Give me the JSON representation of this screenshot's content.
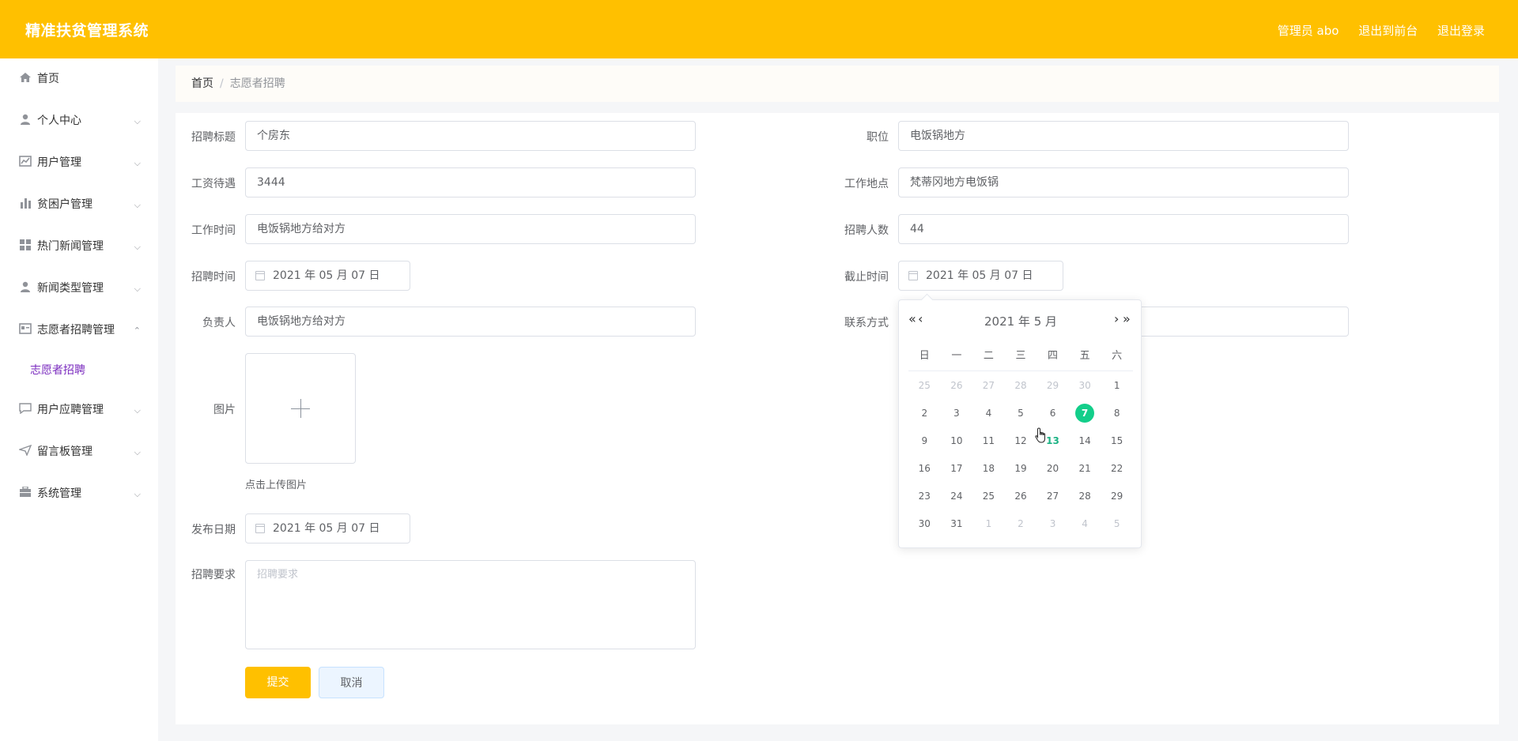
{
  "header": {
    "title": "精准扶贫管理系统",
    "user": "管理员 abo",
    "to_front": "退出到前台",
    "logout": "退出登录"
  },
  "sidebar": {
    "items": [
      {
        "label": "首页",
        "icon": "home-icon"
      },
      {
        "label": "个人中心",
        "icon": "user-icon"
      },
      {
        "label": "用户管理",
        "icon": "chart-icon"
      },
      {
        "label": "贫困户管理",
        "icon": "bar-chart-icon"
      },
      {
        "label": "热门新闻管理",
        "icon": "grid-icon"
      },
      {
        "label": "新闻类型管理",
        "icon": "user-icon"
      },
      {
        "label": "志愿者招聘管理",
        "icon": "card-icon"
      },
      {
        "label": "用户应聘管理",
        "icon": "chat-icon"
      },
      {
        "label": "留言板管理",
        "icon": "send-icon"
      },
      {
        "label": "系统管理",
        "icon": "briefcase-icon"
      }
    ],
    "sub_item": "志愿者招聘"
  },
  "breadcrumb": {
    "home": "首页",
    "separator": "/",
    "current": "志愿者招聘"
  },
  "form": {
    "title_label": "招聘标题",
    "title_value": "个房东",
    "position_label": "职位",
    "position_value": "电饭锅地方",
    "salary_label": "工资待遇",
    "salary_value": "3444",
    "location_label": "工作地点",
    "location_value": "梵蒂冈地方电饭锅",
    "worktime_label": "工作时间",
    "worktime_value": "电饭锅地方给对方",
    "count_label": "招聘人数",
    "count_value": "44",
    "recruit_time_label": "招聘时间",
    "recruit_time_value": "2021 年 05 月 07 日",
    "deadline_label": "截止时间",
    "deadline_value": "2021 年 05 月 07 日",
    "owner_label": "负责人",
    "owner_value": "电饭锅地方给对方",
    "contact_label": "联系方式",
    "contact_value": "",
    "image_label": "图片",
    "upload_hint": "点击上传图片",
    "publish_label": "发布日期",
    "publish_value": "2021 年 05 月 07 日",
    "requirement_label": "招聘要求",
    "requirement_placeholder": "招聘要求",
    "submit": "提交",
    "cancel": "取消"
  },
  "datepicker": {
    "year_month": "2021 年  5 月",
    "prev_year": "«",
    "prev_month": "‹",
    "next_month": "›",
    "next_year": "»",
    "weekdays": [
      "日",
      "一",
      "二",
      "三",
      "四",
      "五",
      "六"
    ],
    "weeks": [
      [
        {
          "d": "25",
          "o": true
        },
        {
          "d": "26",
          "o": true
        },
        {
          "d": "27",
          "o": true
        },
        {
          "d": "28",
          "o": true
        },
        {
          "d": "29",
          "o": true
        },
        {
          "d": "30",
          "o": true
        },
        {
          "d": "1"
        }
      ],
      [
        {
          "d": "2"
        },
        {
          "d": "3"
        },
        {
          "d": "4"
        },
        {
          "d": "5"
        },
        {
          "d": "6"
        },
        {
          "d": "7",
          "s": true
        },
        {
          "d": "8"
        }
      ],
      [
        {
          "d": "9"
        },
        {
          "d": "10"
        },
        {
          "d": "11"
        },
        {
          "d": "12"
        },
        {
          "d": "13",
          "t": true
        },
        {
          "d": "14"
        },
        {
          "d": "15"
        }
      ],
      [
        {
          "d": "16"
        },
        {
          "d": "17"
        },
        {
          "d": "18"
        },
        {
          "d": "19"
        },
        {
          "d": "20"
        },
        {
          "d": "21"
        },
        {
          "d": "22"
        }
      ],
      [
        {
          "d": "23"
        },
        {
          "d": "24"
        },
        {
          "d": "25"
        },
        {
          "d": "26"
        },
        {
          "d": "27"
        },
        {
          "d": "28"
        },
        {
          "d": "29"
        }
      ],
      [
        {
          "d": "30"
        },
        {
          "d": "31"
        },
        {
          "d": "1",
          "o": true
        },
        {
          "d": "2",
          "o": true
        },
        {
          "d": "3",
          "o": true
        },
        {
          "d": "4",
          "o": true
        },
        {
          "d": "5",
          "o": true
        }
      ]
    ]
  },
  "colors": {
    "header": "#ffc000",
    "selected_day": "#13ce8a",
    "submenu_active": "#7b2cbf"
  }
}
